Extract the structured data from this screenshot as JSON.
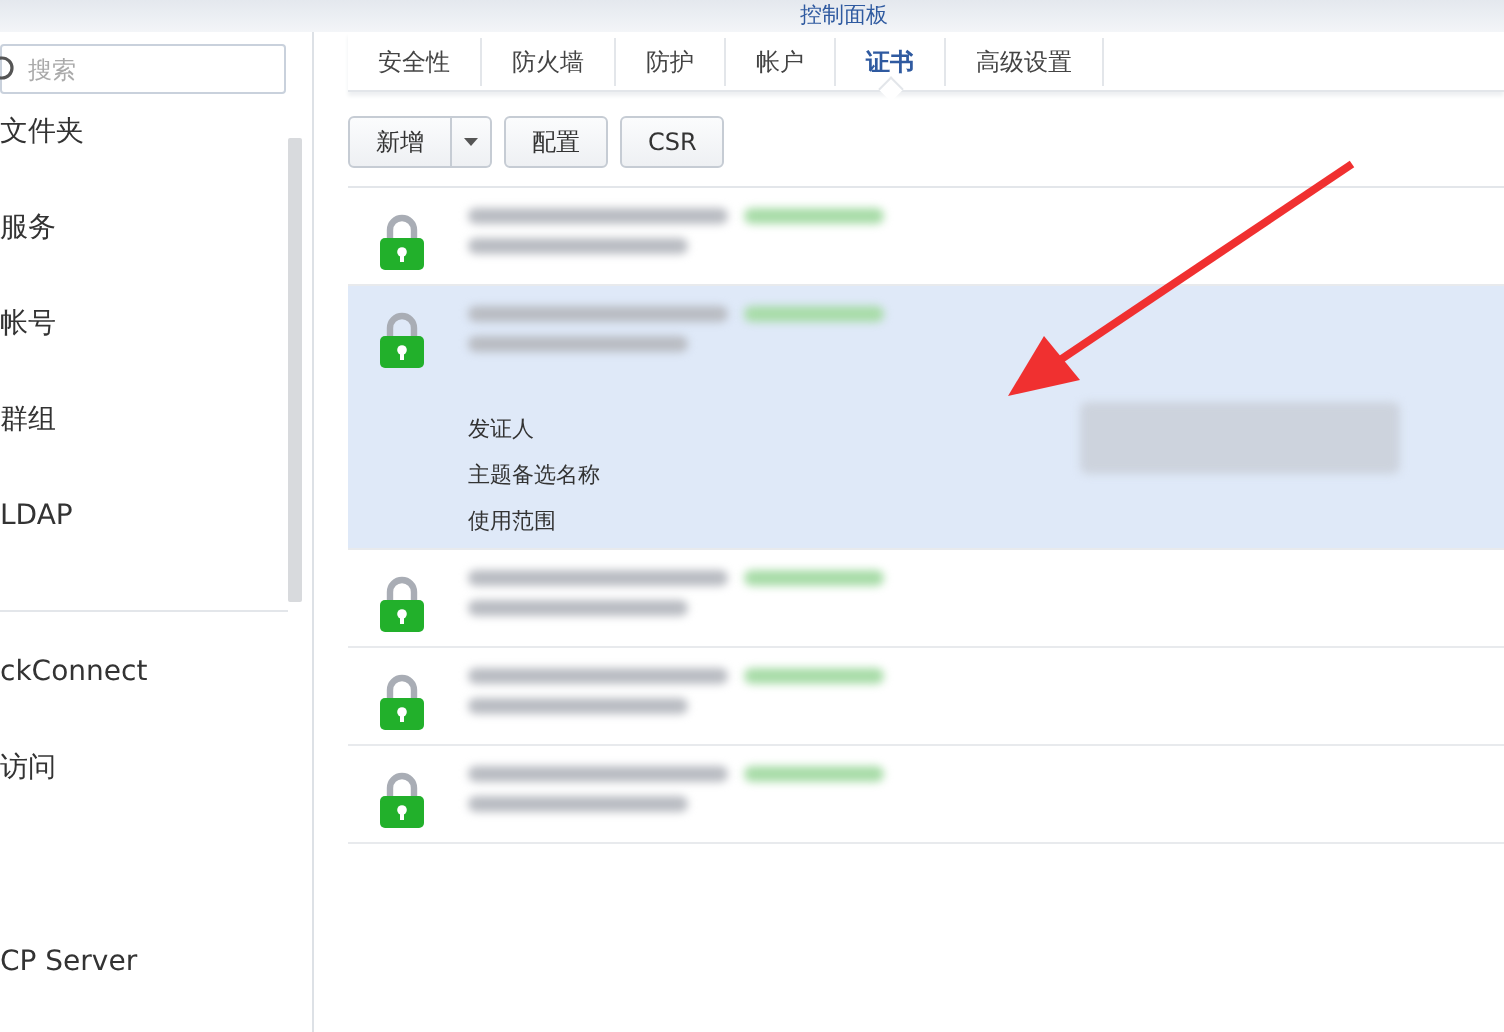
{
  "window": {
    "title": "控制面板"
  },
  "search": {
    "placeholder": "搜索"
  },
  "sidebar": {
    "items": [
      {
        "label": "文件夹",
        "kind": "item"
      },
      {
        "label": "服务",
        "kind": "item"
      },
      {
        "label": "帐号",
        "kind": "item"
      },
      {
        "label": "群组",
        "kind": "item"
      },
      {
        "label": "LDAP",
        "kind": "item"
      },
      {
        "kind": "divider"
      },
      {
        "label": "ckConnect",
        "kind": "item"
      },
      {
        "label": "访问",
        "kind": "item"
      },
      {
        "kind": "gap"
      },
      {
        "label": "CP Server",
        "kind": "item"
      }
    ]
  },
  "tabs": [
    {
      "label": "安全性",
      "selected": false
    },
    {
      "label": "防火墙",
      "selected": false
    },
    {
      "label": "防护",
      "selected": false
    },
    {
      "label": "帐户",
      "selected": false
    },
    {
      "label": "证书",
      "selected": true
    },
    {
      "label": "高级设置",
      "selected": false
    }
  ],
  "toolbar": {
    "add_button": "新增",
    "buttons": [
      "配置",
      "CSR"
    ]
  },
  "certificates": [
    {
      "selected": false
    },
    {
      "selected": true,
      "details": [
        "发证人",
        "主题备选名称",
        "使用范围"
      ]
    },
    {
      "selected": false
    },
    {
      "selected": false
    },
    {
      "selected": false
    }
  ]
}
